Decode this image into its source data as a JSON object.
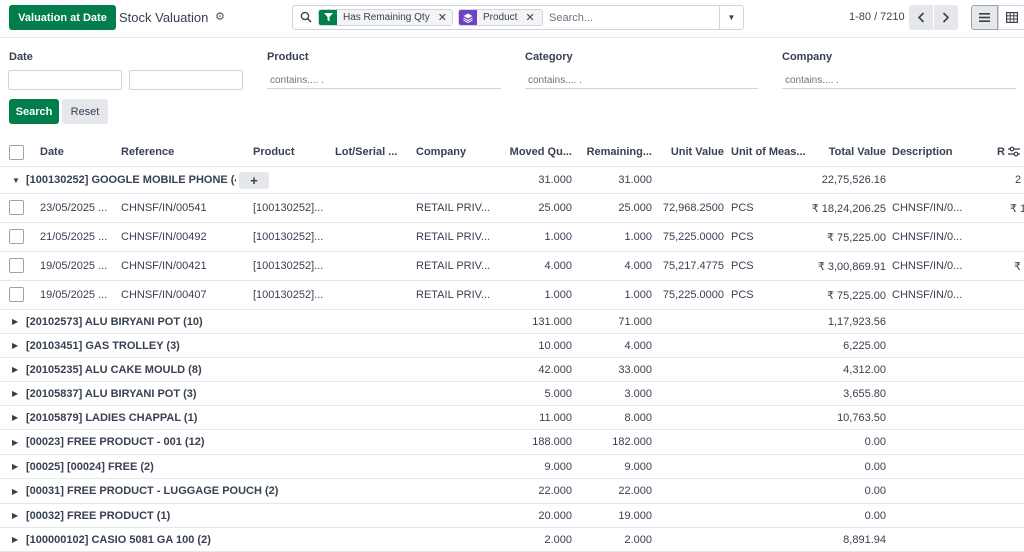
{
  "control_panel": {
    "valuation_button": "Valuation at Date",
    "title": "Stock Valuation",
    "facets": [
      {
        "label": "Has Remaining Qty",
        "icon": "filter-icon",
        "color": "#017e4b"
      },
      {
        "label": "Product",
        "icon": "layers-icon",
        "color": "#6f42c1"
      }
    ],
    "search_placeholder": "Search...",
    "pager": "1-80 / 7210"
  },
  "filters": {
    "date_label": "Date",
    "product_label": "Product",
    "category_label": "Category",
    "company_label": "Company",
    "contains_placeholder": "contains.... .",
    "search_button": "Search",
    "reset_button": "Reset"
  },
  "columns": [
    "Date",
    "Reference",
    "Product",
    "Lot/Serial ...",
    "Company",
    "Moved Qu...",
    "Remaining...",
    "Unit Value",
    "Unit of Meas...",
    "Total Value",
    "Description",
    "R"
  ],
  "expanded_group": {
    "label": "[100130252] GOOGLE MOBILE PHONE (4)",
    "moved": "31.000",
    "remaining": "31.000",
    "total": "22,75,526.16",
    "extra": "2"
  },
  "records": [
    {
      "date": "23/05/2025 ...",
      "reference": "CHNSF/IN/00541",
      "product": "[100130252]...",
      "company": "RETAIL PRIV...",
      "moved": "25.000",
      "remaining": "25.000",
      "unit_value": "72,968.2500",
      "uom": "PCS",
      "total": "₹ 18,24,206.25",
      "description": "CHNSF/IN/0...",
      "extra": "₹ 1"
    },
    {
      "date": "21/05/2025 ...",
      "reference": "CHNSF/IN/00492",
      "product": "[100130252]...",
      "company": "RETAIL PRIV...",
      "moved": "1.000",
      "remaining": "1.000",
      "unit_value": "75,225.0000",
      "uom": "PCS",
      "total": "₹ 75,225.00",
      "description": "CHNSF/IN/0...",
      "extra": ""
    },
    {
      "date": "19/05/2025 ...",
      "reference": "CHNSF/IN/00421",
      "product": "[100130252]...",
      "company": "RETAIL PRIV...",
      "moved": "4.000",
      "remaining": "4.000",
      "unit_value": "75,217.4775",
      "uom": "PCS",
      "total": "₹ 3,00,869.91",
      "description": "CHNSF/IN/0...",
      "extra": "₹"
    },
    {
      "date": "19/05/2025 ...",
      "reference": "CHNSF/IN/00407",
      "product": "[100130252]...",
      "company": "RETAIL PRIV...",
      "moved": "1.000",
      "remaining": "1.000",
      "unit_value": "75,225.0000",
      "uom": "PCS",
      "total": "₹ 75,225.00",
      "description": "CHNSF/IN/0...",
      "extra": ""
    }
  ],
  "groups": [
    {
      "label": "[20102573] ALU BIRYANI POT (10)",
      "moved": "131.000",
      "remaining": "71.000",
      "total": "1,17,923.56"
    },
    {
      "label": "[20103451] GAS TROLLEY (3)",
      "moved": "10.000",
      "remaining": "4.000",
      "total": "6,225.00"
    },
    {
      "label": "[20105235] ALU CAKE MOULD (8)",
      "moved": "42.000",
      "remaining": "33.000",
      "total": "4,312.00"
    },
    {
      "label": "[20105837] ALU BIRYANI POT (3)",
      "moved": "5.000",
      "remaining": "3.000",
      "total": "3,655.80"
    },
    {
      "label": "[20105879] LADIES CHAPPAL (1)",
      "moved": "11.000",
      "remaining": "8.000",
      "total": "10,763.50"
    },
    {
      "label": "[00023] FREE PRODUCT - 001 (12)",
      "moved": "188.000",
      "remaining": "182.000",
      "total": "0.00"
    },
    {
      "label": "[00025] [00024] FREE (2)",
      "moved": "9.000",
      "remaining": "9.000",
      "total": "0.00"
    },
    {
      "label": "[00031] FREE PRODUCT - LUGGAGE POUCH (2)",
      "moved": "22.000",
      "remaining": "22.000",
      "total": "0.00"
    },
    {
      "label": "[00032] FREE PRODUCT (1)",
      "moved": "20.000",
      "remaining": "19.000",
      "total": "0.00"
    },
    {
      "label": "[100000102] CASIO 5081 GA 100 (2)",
      "moved": "2.000",
      "remaining": "2.000",
      "total": "8,891.94"
    }
  ]
}
